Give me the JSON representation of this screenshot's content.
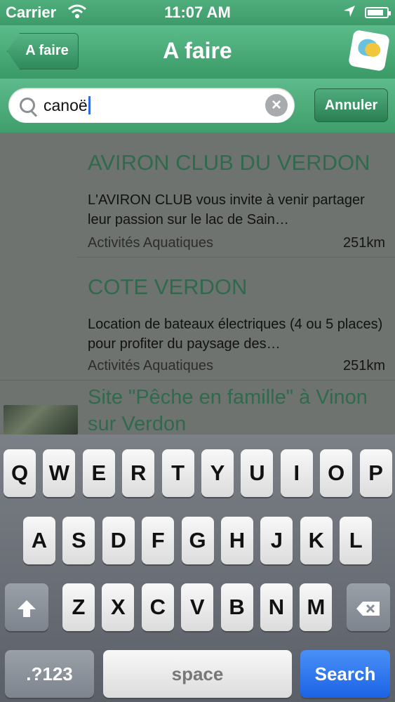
{
  "status_bar": {
    "carrier": "Carrier",
    "time": "11:07 AM",
    "battery_level": 0.85
  },
  "nav": {
    "back_label": "A faire",
    "title": "A faire"
  },
  "search": {
    "query": "canoë",
    "cancel_label": "Annuler"
  },
  "results": [
    {
      "name": "AVIRON CLUB DU VERDON",
      "description": "L'AVIRON CLUB vous invite à venir partager leur passion sur le lac de Sain…",
      "category": "Activités Aquatiques",
      "distance": "251km"
    },
    {
      "name": "COTE VERDON",
      "description": "Location de bateaux électriques (4 ou 5 places) pour profiter du paysage des…",
      "category": "Activités Aquatiques",
      "distance": "251km"
    },
    {
      "name": "Site \"Pêche en famille\" à Vinon sur Verdon"
    }
  ],
  "keyboard": {
    "row1": [
      "Q",
      "W",
      "E",
      "R",
      "T",
      "Y",
      "U",
      "I",
      "O",
      "P"
    ],
    "row2": [
      "A",
      "S",
      "D",
      "F",
      "G",
      "H",
      "J",
      "K",
      "L"
    ],
    "row3": [
      "Z",
      "X",
      "C",
      "V",
      "B",
      "N",
      "M"
    ],
    "numbers_key": ".?123",
    "space_key": "space",
    "search_key": "Search"
  }
}
